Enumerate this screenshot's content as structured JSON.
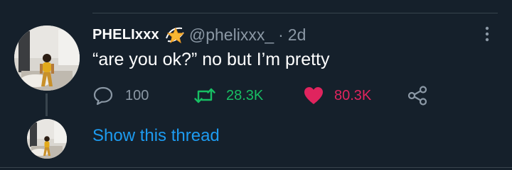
{
  "tweet": {
    "author": {
      "display_name": "PHELIxxx",
      "name_emoji": "dizzy-star-emoji",
      "handle": "@phelixxx_"
    },
    "separator": "·",
    "timestamp": "2d",
    "text": "“are you ok?” no but I’m pretty",
    "actions": {
      "reply_count": "100",
      "retweet_count": "28.3K",
      "like_count": "80.3K",
      "liked": true
    },
    "more_icon": "more-vertical-icon"
  },
  "thread": {
    "link_label": "Show this thread"
  },
  "theme": {
    "background": "#15202b",
    "primary_text": "#ffffff",
    "secondary_text": "#8b98a5",
    "accent": "#1d9bf0",
    "retweet_green": "#17bf63",
    "like_pink": "#e0245e",
    "divider": "#38444d"
  }
}
